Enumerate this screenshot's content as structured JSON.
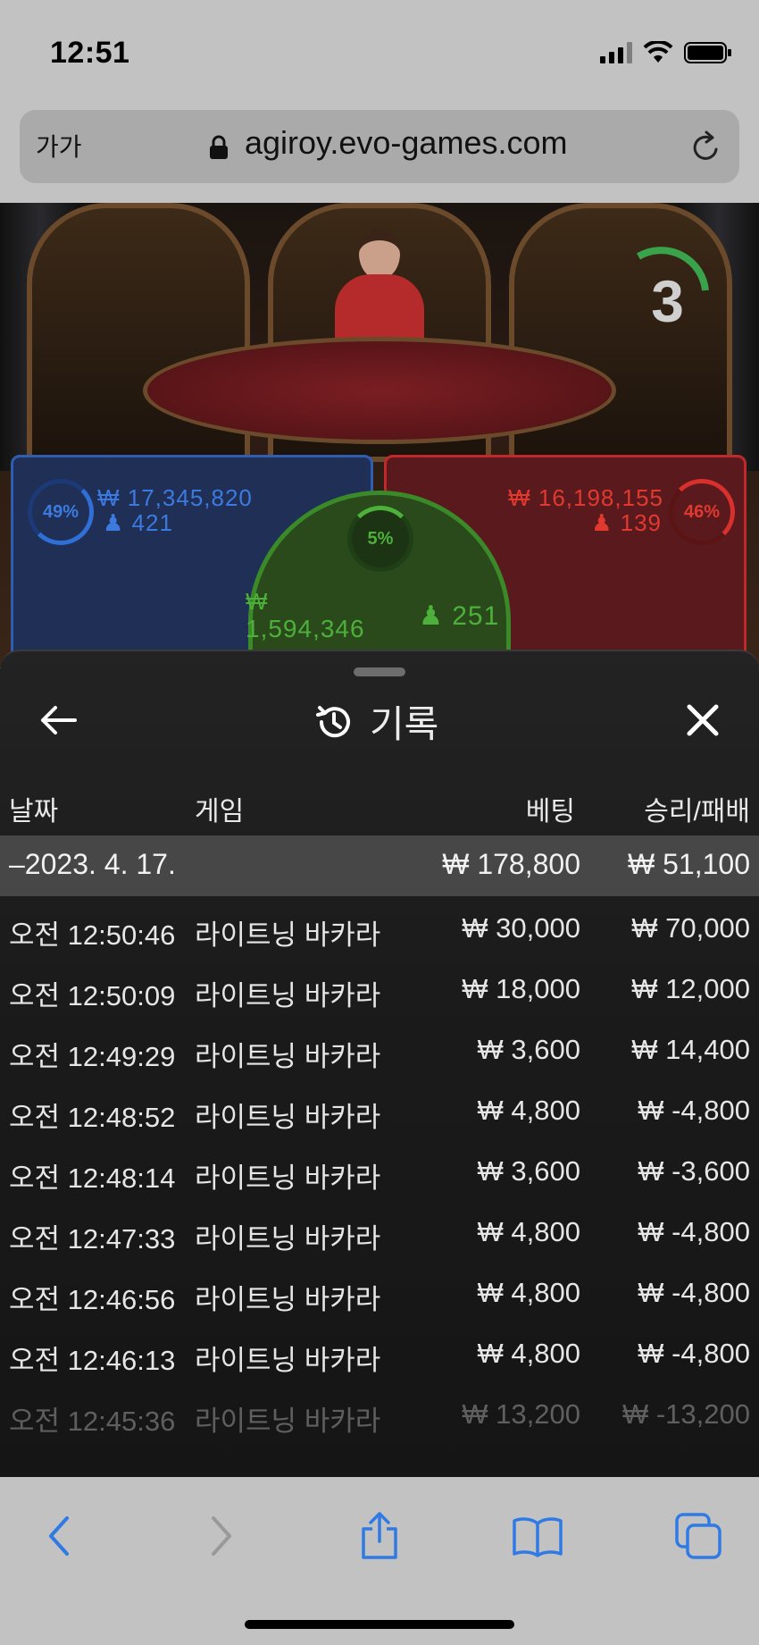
{
  "status": {
    "time": "12:51"
  },
  "browser": {
    "text_size_label": "가가",
    "url": "agiroy.evo-games.com"
  },
  "game": {
    "timer": "3",
    "player": {
      "percent": "49%",
      "amount": "₩ 17,345,820",
      "count": "421",
      "color": "#2f6fd6"
    },
    "banker": {
      "percent": "46%",
      "amount": "₩ 16,198,155",
      "count": "139",
      "color": "#d8302c"
    },
    "tie": {
      "percent": "5%",
      "currency": "₩",
      "amount": "1,594,346",
      "count": "251",
      "color": "#4cb03a"
    }
  },
  "panel": {
    "title": "기록",
    "columns": {
      "date": "날짜",
      "game": "게임",
      "bet": "베팅",
      "winloss": "승리/패배"
    },
    "date_group": {
      "label": "–2023. 4. 17.",
      "bet": "₩ 178,800",
      "winloss": "₩ 51,100"
    },
    "rows": [
      {
        "time": "오전 12:50:46",
        "game": "라이트닝 바카라",
        "bet": "₩ 30,000",
        "winloss": "₩ 70,000"
      },
      {
        "time": "오전 12:50:09",
        "game": "라이트닝 바카라",
        "bet": "₩ 18,000",
        "winloss": "₩ 12,000"
      },
      {
        "time": "오전 12:49:29",
        "game": "라이트닝 바카라",
        "bet": "₩ 3,600",
        "winloss": "₩ 14,400"
      },
      {
        "time": "오전 12:48:52",
        "game": "라이트닝 바카라",
        "bet": "₩ 4,800",
        "winloss": "₩ -4,800"
      },
      {
        "time": "오전 12:48:14",
        "game": "라이트닝 바카라",
        "bet": "₩ 3,600",
        "winloss": "₩ -3,600"
      },
      {
        "time": "오전 12:47:33",
        "game": "라이트닝 바카라",
        "bet": "₩ 4,800",
        "winloss": "₩ -4,800"
      },
      {
        "time": "오전 12:46:56",
        "game": "라이트닝 바카라",
        "bet": "₩ 4,800",
        "winloss": "₩ -4,800"
      },
      {
        "time": "오전 12:46:13",
        "game": "라이트닝 바카라",
        "bet": "₩ 4,800",
        "winloss": "₩ -4,800"
      },
      {
        "time": "오전 12:45:36",
        "game": "라이트닝 바카라",
        "bet": "₩ 13,200",
        "winloss": "₩ -13,200"
      }
    ]
  },
  "icons": {
    "back": "arrow-left-icon",
    "history": "history-icon",
    "close": "close-icon",
    "toolbar": [
      "chevron-left-icon",
      "chevron-right-icon",
      "share-icon",
      "book-icon",
      "tabs-icon"
    ]
  },
  "colors": {
    "accent": "#2f7ae5",
    "panel_bg": "#1b1b1b",
    "date_row_bg": "#474747"
  }
}
